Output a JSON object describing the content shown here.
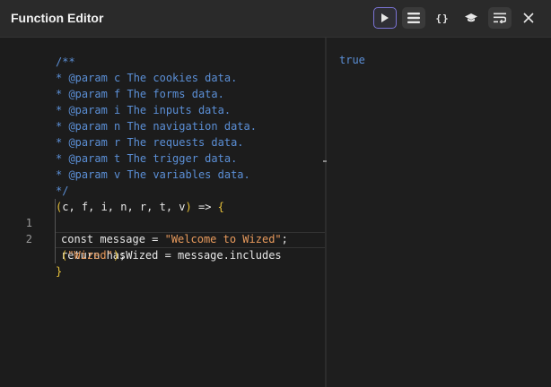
{
  "header": {
    "title": "Function Editor",
    "toolbar": {
      "run_icon": "play-icon",
      "list_icon": "list-icon",
      "braces_label": "{}",
      "hat_icon": "graduation-cap-icon",
      "wrap_icon": "word-wrap-icon",
      "close_icon": "close-icon"
    }
  },
  "editor": {
    "doc_comment": [
      "/**",
      "* @param c The cookies data.",
      "* @param f The forms data.",
      "* @param i The inputs data.",
      "* @param n The navigation data.",
      "* @param r The requests data.",
      "* @param t The trigger data.",
      "* @param v The variables data.",
      "*/"
    ],
    "signature": {
      "open_paren": "(",
      "params": "c, f, i, n, r, t, v",
      "close_paren": ")",
      "arrow": " => ",
      "open_brace": "{"
    },
    "lines": [
      {
        "number": "1",
        "keyword": "const",
        "text": " message = ",
        "string": "\"Welcome to Wized\"",
        "end": ";"
      },
      {
        "number": "2",
        "keyword": "return",
        "text": " hasWized = message.includes"
      }
    ],
    "wrap": {
      "open_paren": "(",
      "string": "\"Wized\"",
      "close_paren": ")",
      "end": ";"
    },
    "close_brace": "}"
  },
  "output": {
    "result": "true"
  },
  "colors": {
    "comment": "#5b8fd6",
    "string": "#e89a5c",
    "paren": "#e8c23a",
    "accent_border": "#7b74d6"
  }
}
